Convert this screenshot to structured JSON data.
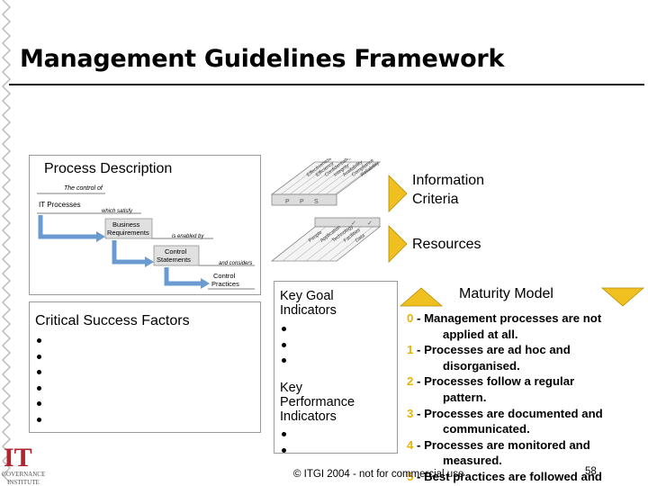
{
  "slide": {
    "title": "Management Guidelines Framework",
    "footer": "© ITGI 2004 - not for commercial use",
    "page_number": "58"
  },
  "process_description": {
    "title": "Process Description",
    "diagram": {
      "top_label": "The control of",
      "it_processes": "IT Processes",
      "which_satisfy": "which satisfy",
      "business_requirements_1": "Business",
      "business_requirements_2": "Requirements",
      "is_enabled_by": "is enabled by",
      "control_statements_1": "Control",
      "control_statements_2": "Statements",
      "and_considers": "and considers",
      "control_practices_1": "Control",
      "control_practices_2": "Practices"
    }
  },
  "information_criteria": {
    "label_line1": "Information",
    "label_line2": "Criteria",
    "cube_labels": [
      "Effectiveness",
      "Efficiency",
      "Confidentiality",
      "Integrity",
      "Availability",
      "Compliance",
      "Reliability"
    ],
    "cube_marks": [
      "P",
      "P",
      "S"
    ]
  },
  "resources": {
    "label": "Resources",
    "cube_labels": [
      "People",
      "Application",
      "Technology",
      "Facilities",
      "Data"
    ],
    "cube_marks": [
      "✓",
      "✓"
    ]
  },
  "critical_success_factors": {
    "title": "Critical Success Factors",
    "bullet_count": 6
  },
  "key_goal_indicators": {
    "title_line1": "Key Goal",
    "title_line2": "Indicators",
    "bullet_count": 3
  },
  "key_performance_indicators": {
    "title_line1": "Key",
    "title_line2": "Performance",
    "title_line3": "Indicators",
    "bullet_count": 2
  },
  "maturity_model": {
    "title": "Maturity Model",
    "levels": [
      {
        "num": "0",
        "line1": " -  Management processes are not",
        "line2": "applied at all."
      },
      {
        "num": "1",
        "line1": " - Processes are ad hoc and",
        "line2": "disorganised."
      },
      {
        "num": "2",
        "line1": " - Processes follow a regular",
        "line2": "pattern."
      },
      {
        "num": "3",
        "line1": " - Processes are documented and",
        "line2": "communicated."
      },
      {
        "num": "4",
        "line1": " - Processes are monitored and",
        "line2": "measured."
      },
      {
        "num": "5",
        "line1": " - Best practices are followed and",
        "line2": ""
      }
    ]
  },
  "logo": {
    "letters": "IT",
    "line1": "GOVERNANCE",
    "line2": "INSTITUTE"
  },
  "colors": {
    "accent_yellow": "#f0c020",
    "number_yellow": "#e8b400",
    "logo_red": "#b0252f",
    "zigzag": "#c8c8c8"
  }
}
